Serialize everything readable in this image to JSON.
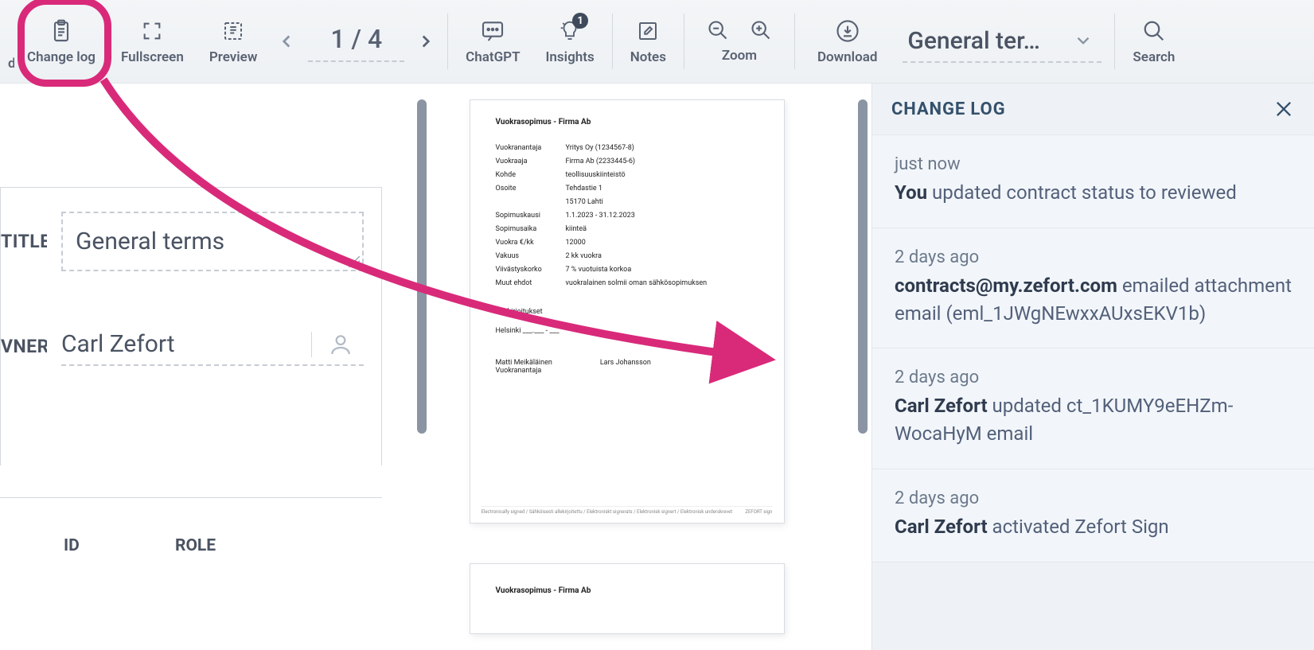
{
  "toolbar": {
    "truncated_left": "d",
    "change_log": "Change log",
    "fullscreen": "Fullscreen",
    "preview": "Preview",
    "page_display": "1 / 4",
    "chatgpt": "ChatGPT",
    "insights": "Insights",
    "insights_badge": "1",
    "notes": "Notes",
    "zoom": "Zoom",
    "download": "Download",
    "dropdown_text": "General ter…",
    "search": "Search"
  },
  "form": {
    "title_label": "TITLE",
    "title_value": "General terms",
    "owner_label": "VNER",
    "owner_value": "Carl Zefort",
    "table": {
      "id_header": "ID",
      "role_header": "ROLE"
    }
  },
  "document": {
    "title": "Vuokrasopimus - Firma Ab",
    "rows": [
      {
        "k": "Vuokranantaja",
        "v": "Yritys Oy (1234567-8)"
      },
      {
        "k": "Vuokraaja",
        "v": "Firma Ab (2233445-6)"
      },
      {
        "k": "Kohde",
        "v": "teollisuuskiinteistö"
      },
      {
        "k": "Osoite",
        "v": "Tehdastie 1"
      },
      {
        "k": "",
        "v": "15170 Lahti"
      },
      {
        "k": "Sopimuskausi",
        "v": "1.1.2023 - 31.12.2023"
      },
      {
        "k": "Sopimusaika",
        "v": "kiinteä"
      },
      {
        "k": "Vuokra €/kk",
        "v": "12000"
      },
      {
        "k": "Vakuus",
        "v": "2 kk vuokra"
      },
      {
        "k": "Viivästyskorko",
        "v": "7 % vuotuista korkoa"
      },
      {
        "k": "Muut ehdot",
        "v": "vuokralainen solmii oman sähkösopimuksen"
      }
    ],
    "signatures_label": "Allekirjoitukset",
    "sign_city": "Helsinki ___.___ - ___",
    "signer1_name": "Matti Meikäläinen",
    "signer1_role": "Vuokranantaja",
    "signer2_name": "Lars Johansson",
    "signer2_role": " ",
    "footer_left": "Electronically signed / Sähköisesti allekirjoitettu / Elektroniskt signerats / Elektronisk signert / Elektronisk underskrevet",
    "footer_right": "ZEFORT sign"
  },
  "change_log": {
    "heading": "CHANGE LOG",
    "entries": [
      {
        "time": "just now",
        "actor": "You",
        "action": " updated contract status to reviewed"
      },
      {
        "time": "2 days ago",
        "actor": "contracts@my.zefort.com",
        "action": " emailed attach­ment email (eml_1JWgNEwxxAUxsEKV1b)"
      },
      {
        "time": "2 days ago",
        "actor": "Carl Zefort",
        "action": " updated ct_1KUMY9eEHZm­WocaHyM email"
      },
      {
        "time": "2 days ago",
        "actor": "Carl Zefort",
        "action": " activated Zefort Sign"
      }
    ]
  }
}
